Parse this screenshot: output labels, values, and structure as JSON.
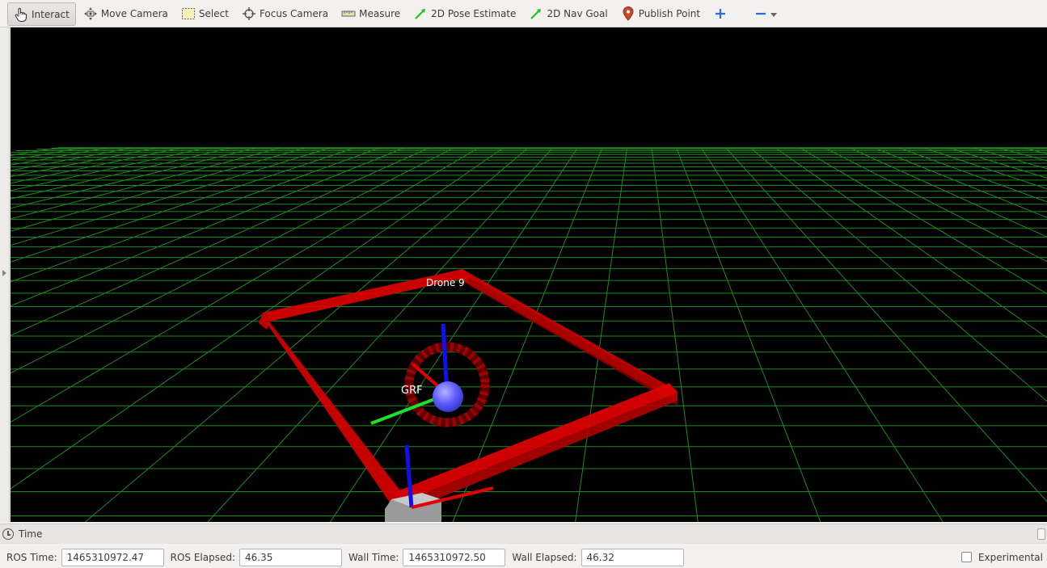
{
  "toolbar": {
    "tools": [
      {
        "label": "Interact",
        "icon": "hand-pointer-icon",
        "active": true
      },
      {
        "label": "Move Camera",
        "icon": "move-camera-icon"
      },
      {
        "label": "Select",
        "icon": "select-box-icon"
      },
      {
        "label": "Focus Camera",
        "icon": "focus-crosshair-icon"
      },
      {
        "label": "Measure",
        "icon": "ruler-icon"
      },
      {
        "label": "2D Pose Estimate",
        "icon": "green-arrow-icon"
      },
      {
        "label": "2D Nav Goal",
        "icon": "green-arrow-icon"
      },
      {
        "label": "Publish Point",
        "icon": "map-pin-icon"
      }
    ],
    "add_icon": "plus-icon",
    "remove_icon": "minus-icon"
  },
  "viewport": {
    "background": "#000000",
    "grid_color": "#1f8a1f",
    "marker_color": "#ff0000",
    "drone_label": "Drone  9",
    "frame_label": "GRF",
    "sphere_color": "#5b5bff"
  },
  "time_panel": {
    "title": "Time",
    "ros_time_label": "ROS Time:",
    "ros_time_value": "1465310972.47",
    "ros_elapsed_label": "ROS Elapsed:",
    "ros_elapsed_value": "46.35",
    "wall_time_label": "Wall Time:",
    "wall_time_value": "1465310972.50",
    "wall_elapsed_label": "Wall Elapsed:",
    "wall_elapsed_value": "46.32",
    "experimental_label": "Experimental"
  }
}
